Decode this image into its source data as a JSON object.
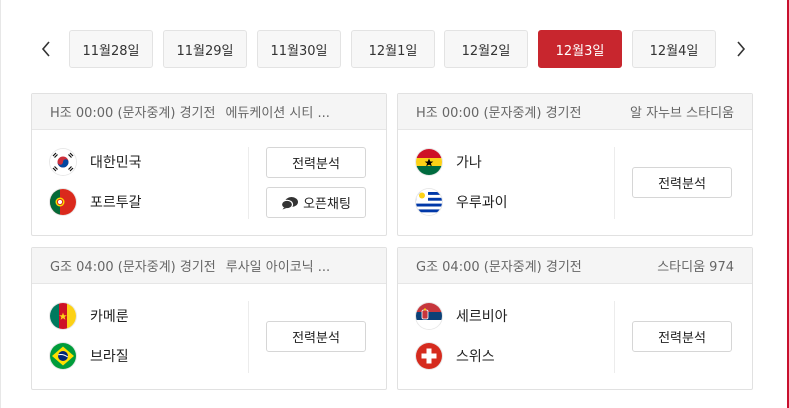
{
  "date_nav": {
    "prev_icon": "chevron-left-icon",
    "next_icon": "chevron-right-icon",
    "dates": [
      "11월28일",
      "11월29일",
      "11월30일",
      "12월1일",
      "12월2일",
      "12월3일",
      "12월4일"
    ],
    "active": "12월3일"
  },
  "matches": [
    {
      "info": "H조 00:00 (문자중계) 경기전",
      "venue": "에듀케이션 시티 ...",
      "home": {
        "name": "대한민국",
        "flag": "south-korea-flag-icon"
      },
      "away": {
        "name": "포르투갈",
        "flag": "portugal-flag-icon"
      },
      "analysis_label": "전력분석",
      "chat_label": "오픈채팅"
    },
    {
      "info": "H조 00:00 (문자중계) 경기전",
      "venue": "알 자누브 스타디움",
      "home": {
        "name": "가나",
        "flag": "ghana-flag-icon"
      },
      "away": {
        "name": "우루과이",
        "flag": "uruguay-flag-icon"
      },
      "analysis_label": "전력분석"
    },
    {
      "info": "G조 04:00 (문자중계) 경기전",
      "venue": "루사일 아이코닉 ...",
      "home": {
        "name": "카메룬",
        "flag": "cameroon-flag-icon"
      },
      "away": {
        "name": "브라질",
        "flag": "brazil-flag-icon"
      },
      "analysis_label": "전력분석"
    },
    {
      "info": "G조 04:00 (문자중계) 경기전",
      "venue": "스타디움 974",
      "home": {
        "name": "세르비아",
        "flag": "serbia-flag-icon"
      },
      "away": {
        "name": "스위스",
        "flag": "switzerland-flag-icon"
      },
      "analysis_label": "전력분석"
    }
  ],
  "colors": {
    "accent": "#c8262e"
  }
}
